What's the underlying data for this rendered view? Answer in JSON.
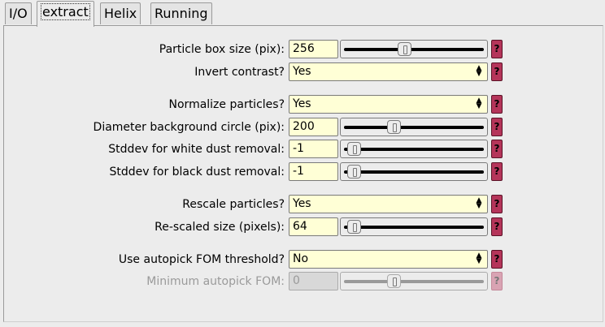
{
  "tabs": [
    {
      "label": "I/O"
    },
    {
      "label": "extract"
    },
    {
      "label": "Helix"
    },
    {
      "label": "Running"
    }
  ],
  "help_label": "?",
  "fields": {
    "box_size": {
      "label": "Particle box size (pix):",
      "value": "256",
      "slider_fraction": 0.42
    },
    "invert_contrast": {
      "label": "Invert contrast?",
      "value": "Yes"
    },
    "normalize": {
      "label": "Normalize particles?",
      "value": "Yes"
    },
    "bg_diameter": {
      "label": "Diameter background circle (pix):",
      "value": "200",
      "slider_fraction": 0.33
    },
    "white_dust": {
      "label": "Stddev for white dust removal:",
      "value": "-1",
      "slider_fraction": 0.0
    },
    "black_dust": {
      "label": "Stddev for black dust removal:",
      "value": "-1",
      "slider_fraction": 0.0
    },
    "rescale": {
      "label": "Rescale particles?",
      "value": "Yes"
    },
    "rescaled_size": {
      "label": "Re-scaled size (pixels):",
      "value": "64",
      "slider_fraction": 0.0
    },
    "autopick_fom": {
      "label": "Use autopick FOM threshold?",
      "value": "No"
    },
    "min_fom": {
      "label": "Minimum autopick FOM:",
      "value": "0",
      "slider_fraction": 0.33,
      "disabled": true
    }
  },
  "colors": {
    "input_bg": "#ffffd6",
    "help_bg": "#b5355a",
    "window_bg": "#ececec"
  }
}
